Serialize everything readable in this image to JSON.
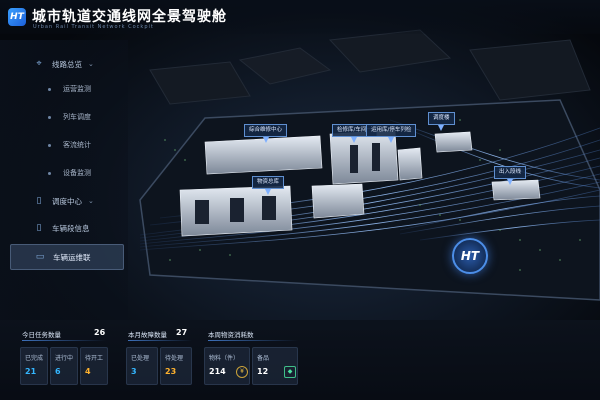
{
  "header": {
    "logo_text": "HT",
    "title": "城市轨道交通线网全景驾驶舱",
    "subtitle": "Urban Rail Transit Network Cockpit"
  },
  "sidebar": {
    "items": [
      {
        "label": "线路总览",
        "icon": "map-pin-icon",
        "expanded": true
      },
      {
        "label": "运营监测"
      },
      {
        "label": "列车调度"
      },
      {
        "label": "客流统计"
      },
      {
        "label": "设备监测"
      },
      {
        "label": "调度中心",
        "icon": "train-icon",
        "expanded": false
      },
      {
        "label": "车辆段信息",
        "icon": "train-icon"
      },
      {
        "label": "车辆运维联",
        "icon": "bus-icon",
        "active": true
      }
    ]
  },
  "map": {
    "callouts": [
      "综合维修中心",
      "检修库/车间一",
      "运用库/停车列检",
      "调度楼",
      "物资总库",
      "出入段线"
    ],
    "logo_text": "HT"
  },
  "stats": {
    "groups": [
      {
        "label": "今日任务数量",
        "value": "26",
        "cards": [
          {
            "label": "已完成",
            "value": "21",
            "color": "blue"
          },
          {
            "label": "进行中",
            "value": "6",
            "color": "blue"
          },
          {
            "label": "待开工",
            "value": "4",
            "color": "orange"
          }
        ]
      },
      {
        "label": "本月故障数量",
        "value": "27",
        "cards": [
          {
            "label": "已处理",
            "value": "3",
            "color": "blue"
          },
          {
            "label": "待处理",
            "value": "23",
            "color": "orange"
          }
        ]
      },
      {
        "label": "本周物资消耗数",
        "value": "",
        "cards": [
          {
            "label": "物料（件）",
            "value": "214",
            "color": "white",
            "icon": "coin-icon"
          },
          {
            "label": "备品",
            "value": "12",
            "color": "white",
            "icon": "cube-icon"
          }
        ]
      }
    ]
  },
  "colors": {
    "accent": "#34b6ff",
    "warning": "#ffb22e",
    "background": "#05080d"
  }
}
